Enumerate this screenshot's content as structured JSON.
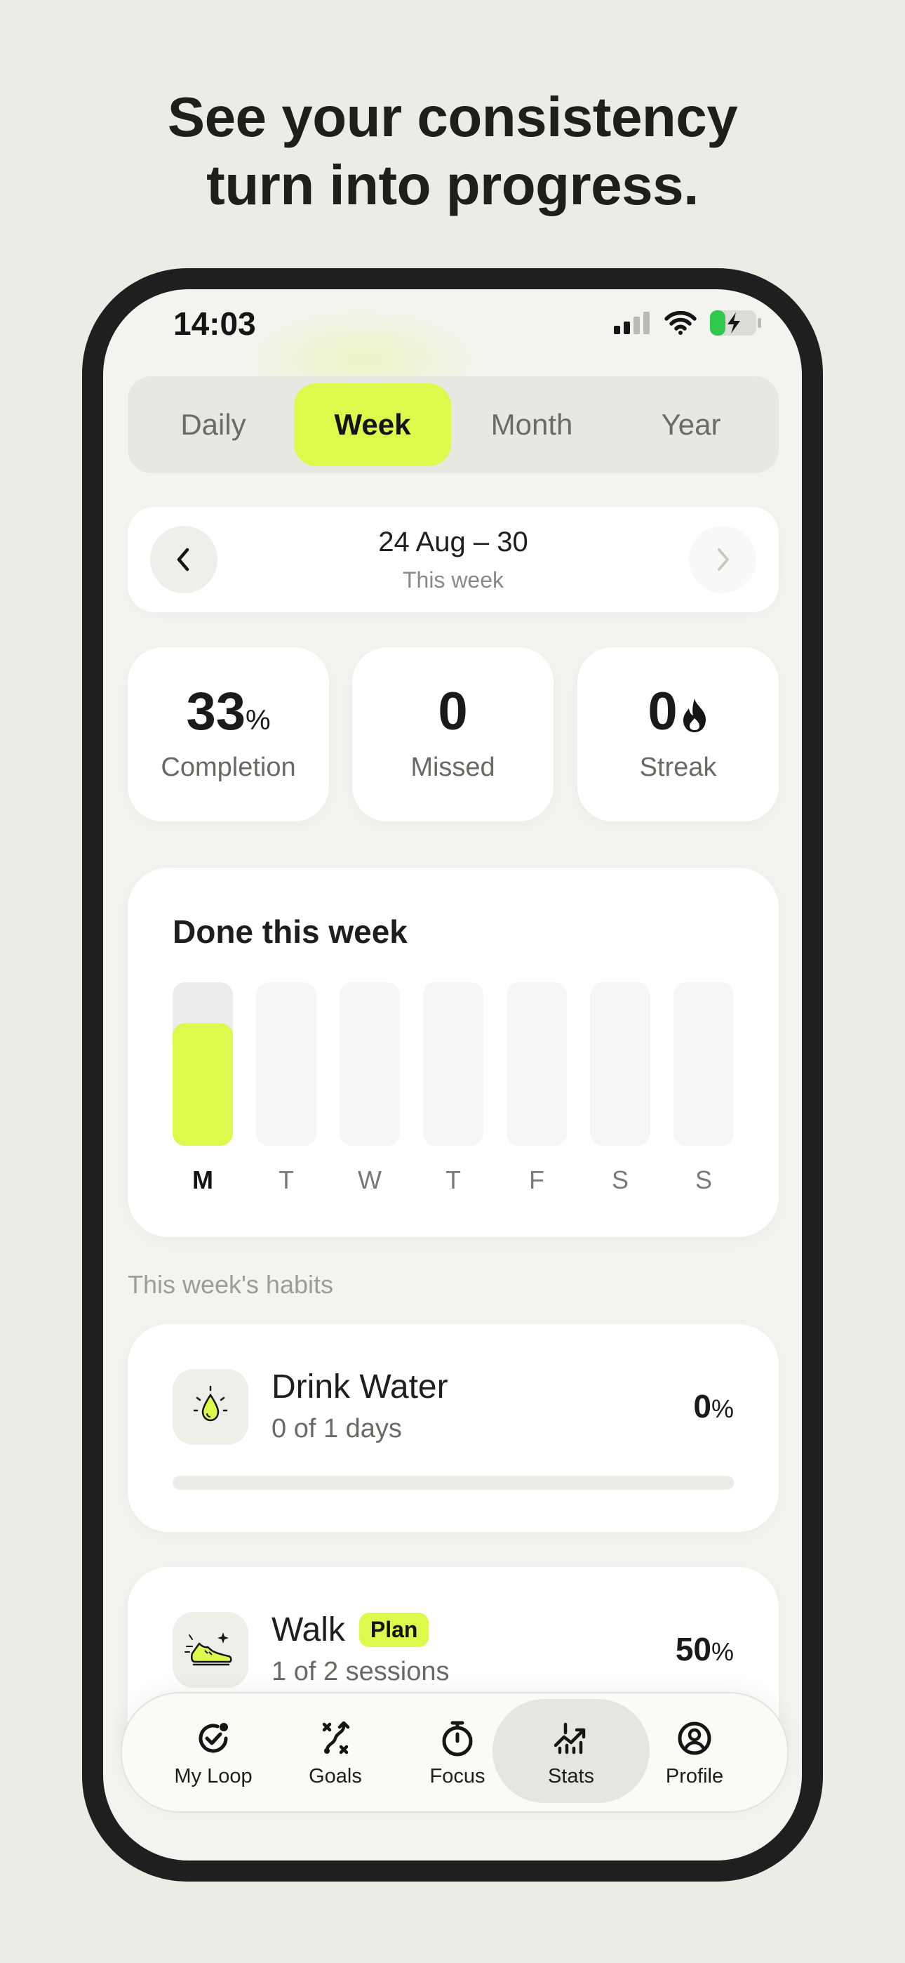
{
  "headline": {
    "line1": "See your consistency",
    "line2": "turn into progress."
  },
  "status_bar": {
    "time": "14:03",
    "icons": [
      "signal-icon",
      "wifi-icon",
      "battery-charging-icon"
    ]
  },
  "segments": {
    "items": [
      "Daily",
      "Week",
      "Month",
      "Year"
    ],
    "selected": "Week"
  },
  "week_nav": {
    "range": "24 Aug – 30",
    "subtitle": "This week",
    "prev_icon": "chevron-left-icon",
    "next_icon": "chevron-right-icon"
  },
  "stats": {
    "completion": {
      "value": "33",
      "unit": "%",
      "label": "Completion"
    },
    "missed": {
      "value": "0",
      "label": "Missed"
    },
    "streak": {
      "value": "0",
      "label": "Streak",
      "icon": "flame-icon"
    }
  },
  "chart_data": {
    "type": "bar",
    "title": "Done this week",
    "categories": [
      "M",
      "T",
      "W",
      "T",
      "F",
      "S",
      "S"
    ],
    "values": [
      0.75,
      0,
      0,
      0,
      0,
      0,
      0
    ],
    "ylim": [
      0,
      1
    ],
    "highlight_index": 0,
    "colors": {
      "fill": "#dcfa4b",
      "track_active": "#ececea",
      "track": "#f6f6f4"
    }
  },
  "habits_section": {
    "label": "This week's habits",
    "items": [
      {
        "name": "Drink Water",
        "badge": "",
        "sub": "0 of 1 days",
        "pct": "0",
        "unit": "%",
        "progress": 0,
        "icon": "water-drop-icon"
      },
      {
        "name": "Walk",
        "badge": "Plan",
        "sub": "1 of 2 sessions",
        "pct": "50",
        "unit": "%",
        "progress": 0.5,
        "icon": "sneaker-icon"
      }
    ]
  },
  "tabbar": {
    "items": [
      {
        "label": "My Loop",
        "icon": "check-circle-icon"
      },
      {
        "label": "Goals",
        "icon": "route-icon"
      },
      {
        "label": "Focus",
        "icon": "stopwatch-icon"
      },
      {
        "label": "Stats",
        "icon": "trending-chart-icon"
      },
      {
        "label": "Profile",
        "icon": "user-circle-icon"
      }
    ],
    "selected": "Stats"
  },
  "colors": {
    "accent": "#dcfa4b",
    "background": "#ecebe6",
    "card": "#ffffff",
    "phone_frame": "#1f1f1f"
  }
}
